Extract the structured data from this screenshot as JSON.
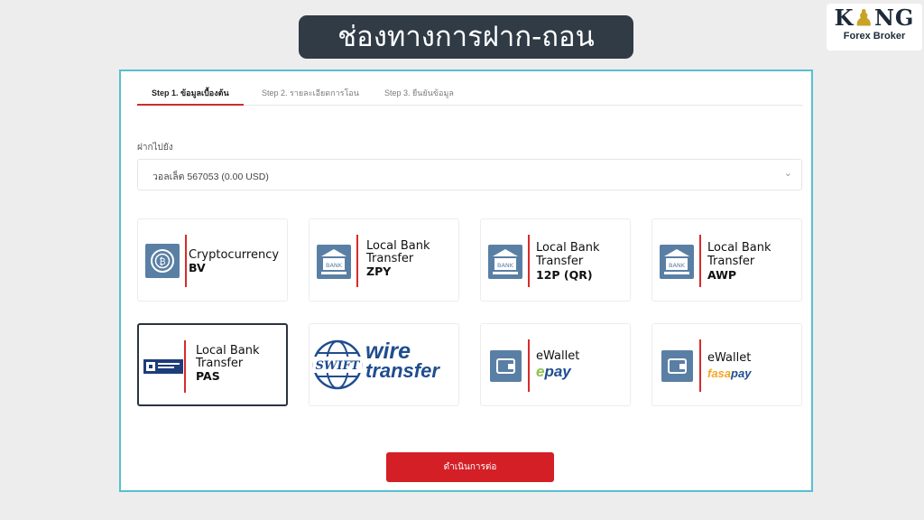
{
  "banner": {
    "title": "ช่องทางการฝาก-ถอน"
  },
  "logo": {
    "word_left": "K",
    "word_right": "NG",
    "subtitle": "Forex Broker"
  },
  "steps": [
    {
      "label": "Step 1. ข้อมูลเบื้องต้น",
      "active": true
    },
    {
      "label": "Step 2. รายละเอียดการโอน",
      "active": false
    },
    {
      "label": "Step 3. ยืนยันข้อมูล",
      "active": false
    }
  ],
  "deposit": {
    "label": "ฝากไปยัง",
    "selected_wallet": "วอลเล็ต 567053 (0.00 USD)"
  },
  "methods": {
    "crypto": {
      "line1": "Cryptocurrency",
      "line2": "BV"
    },
    "zpy": {
      "line1": "Local Bank",
      "line2": "Transfer",
      "line3": "ZPY"
    },
    "p12": {
      "line1": "Local Bank",
      "line2": "Transfer",
      "line3": "12P (QR)"
    },
    "awp": {
      "line1": "Local Bank",
      "line2": "Transfer",
      "line3": "AWP"
    },
    "pas": {
      "line1": "Local Bank",
      "line2": "Transfer",
      "line3": "PAS"
    },
    "wire": {
      "swift": "SWIFT",
      "line1": "wire",
      "line2": "transfer"
    },
    "epay": {
      "line1": "eWallet",
      "brand": "epay"
    },
    "fasapay": {
      "line1": "eWallet",
      "brand": "fasapay"
    }
  },
  "bank_icon_text": "BANK",
  "proceed_label": "ดำเนินการต่อ",
  "colors": {
    "accent_red": "#d41f26",
    "icon_blue": "#5a7fa5",
    "frame_border": "#57bfd2",
    "banner_bg": "#303b46"
  }
}
